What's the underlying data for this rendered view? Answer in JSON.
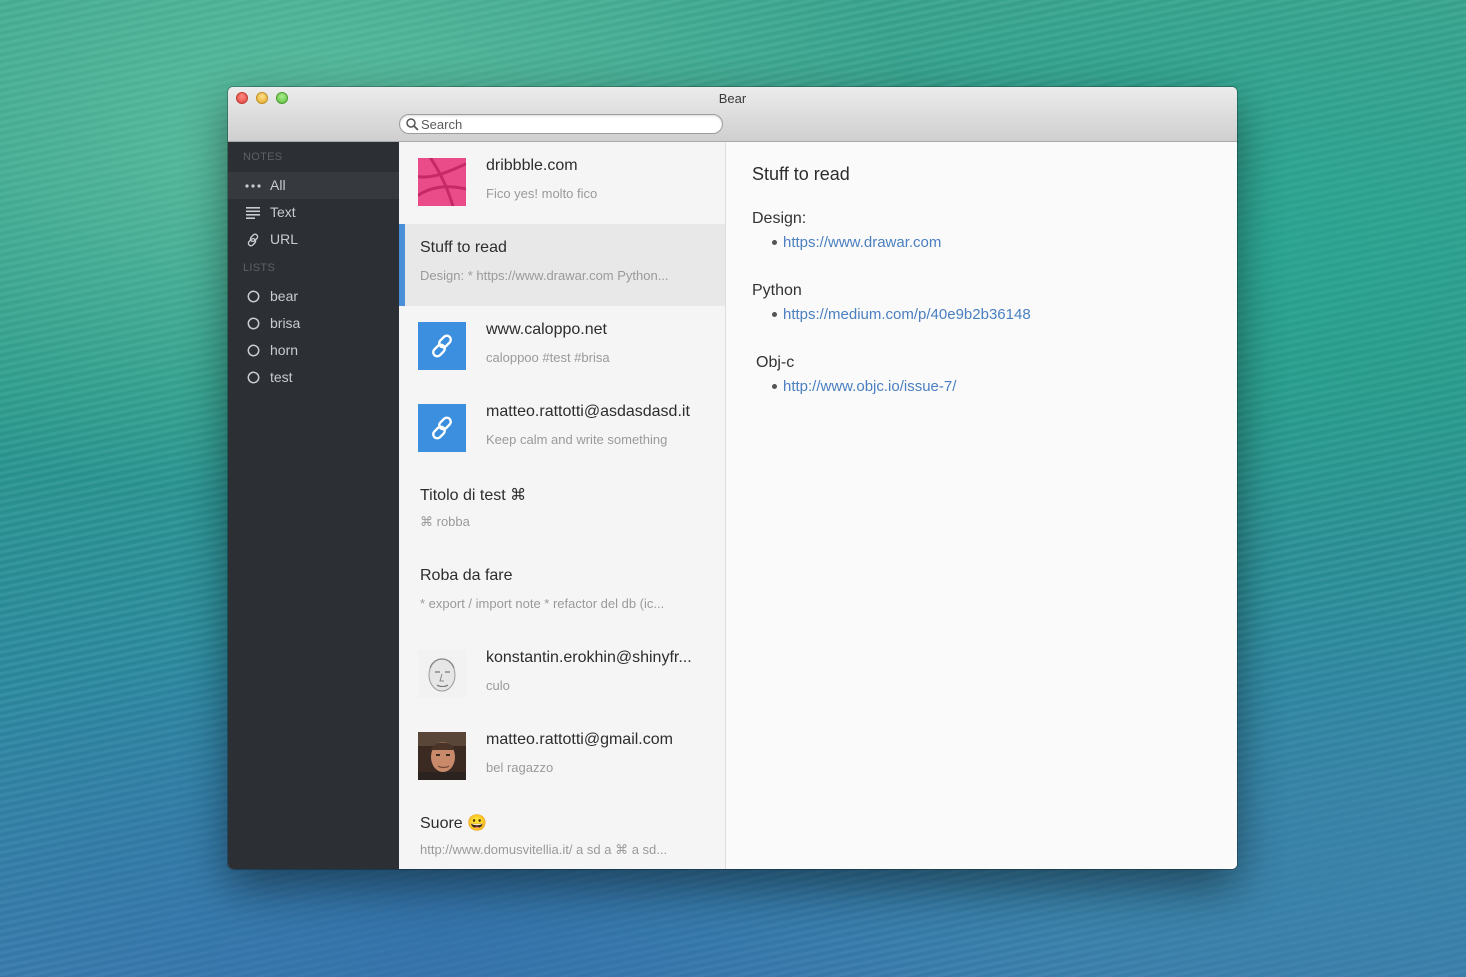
{
  "window": {
    "title": "Bear"
  },
  "search": {
    "placeholder": "Search"
  },
  "sidebar": {
    "notes_header": "NOTES",
    "notes_items": [
      {
        "label": "All",
        "icon": "ellipsis-icon"
      },
      {
        "label": "Text",
        "icon": "text-lines-icon"
      },
      {
        "label": "URL",
        "icon": "link-icon"
      }
    ],
    "lists_header": "LISTS",
    "lists_items": [
      {
        "label": "bear",
        "icon": "circle-icon"
      },
      {
        "label": "brisa",
        "icon": "circle-icon"
      },
      {
        "label": "horn",
        "icon": "circle-icon"
      },
      {
        "label": "test",
        "icon": "circle-icon"
      }
    ]
  },
  "notes": [
    {
      "title": "dribbble.com",
      "subtitle": "Fico yes! molto fico",
      "thumb": "dribbble-thumb"
    },
    {
      "title": "Stuff to read",
      "subtitle": "Design: * https://www.drawar.com  Python...",
      "selected": true
    },
    {
      "title": "www.caloppo.net",
      "subtitle": "caloppoo  #test #brisa",
      "thumb": "link-thumb"
    },
    {
      "title": "matteo.rattotti@asdasdasd.it",
      "subtitle": "Keep calm and write something",
      "thumb": "link-thumb"
    },
    {
      "title": "Titolo di test ⌘",
      "subtitle": "⌘ robba"
    },
    {
      "title": "Roba da fare",
      "subtitle": "* export / import note * refactor del db (ic..."
    },
    {
      "title": "konstantin.erokhin@shinyfr...",
      "subtitle": "culo",
      "thumb": "sketch-avatar-thumb"
    },
    {
      "title": "matteo.rattotti@gmail.com",
      "subtitle": "bel ragazzo",
      "thumb": "photo-avatar-thumb"
    },
    {
      "title": "Suore 😀",
      "subtitle": "http://www.domusvitellia.it/  a sd a ⌘ a sd..."
    }
  ],
  "document": {
    "title": "Stuff to read",
    "sections": [
      {
        "heading": "Design:",
        "link": "https://www.drawar.com"
      },
      {
        "heading": "Python",
        "link": "https://medium.com/p/40e9b2b36148"
      },
      {
        "heading": "Obj-c",
        "link": "http://www.objc.io/issue-7/"
      }
    ]
  },
  "colors": {
    "accent": "#4a90d9",
    "link": "#4a7fc1",
    "sidebar_bg": "#2c2f33",
    "dribbble_pink": "#ea4c89",
    "link_thumb_blue": "#3b8fde"
  }
}
